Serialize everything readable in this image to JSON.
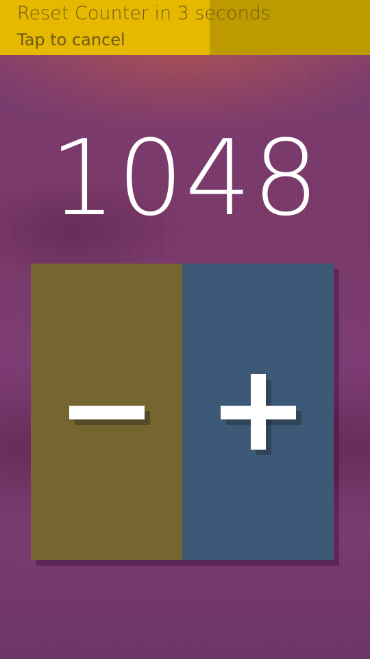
{
  "banner": {
    "title": "Reset Counter in 3 seconds",
    "subtitle": "Tap to cancel",
    "progress_fraction": 0.567
  },
  "counter": {
    "value": "1048"
  },
  "buttons": {
    "decrement_icon": "minus-icon",
    "increment_icon": "plus-icon"
  },
  "colors": {
    "banner_active": "#e6b800",
    "banner_remaining": "#bd9a00",
    "decrement_bg": "#75652f",
    "increment_bg": "#3c5a78"
  }
}
